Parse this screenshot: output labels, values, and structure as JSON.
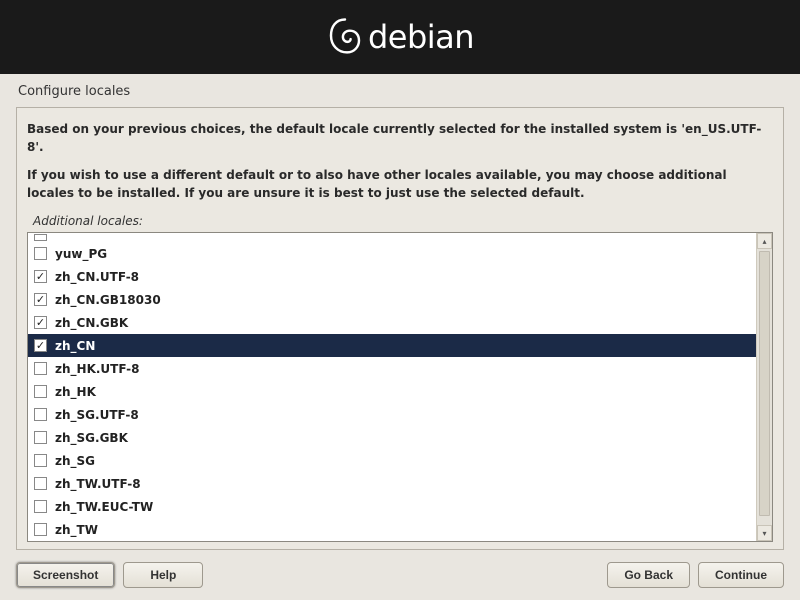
{
  "header": {
    "brand": "debian"
  },
  "title": "Configure locales",
  "description": {
    "line1": "Based on your previous choices, the default locale currently selected for the installed system is 'en_US.UTF-8'.",
    "line2": "If you wish to use a different default or to also have other locales available, you may choose additional locales to be installed. If you are unsure it is best to just use the selected default."
  },
  "list_label": "Additional locales:",
  "locales": [
    {
      "label": "yuw_PG",
      "checked": false,
      "selected": false
    },
    {
      "label": "zh_CN.UTF-8",
      "checked": true,
      "selected": false
    },
    {
      "label": "zh_CN.GB18030",
      "checked": true,
      "selected": false
    },
    {
      "label": "zh_CN.GBK",
      "checked": true,
      "selected": false
    },
    {
      "label": "zh_CN",
      "checked": true,
      "selected": true
    },
    {
      "label": "zh_HK.UTF-8",
      "checked": false,
      "selected": false
    },
    {
      "label": "zh_HK",
      "checked": false,
      "selected": false
    },
    {
      "label": "zh_SG.UTF-8",
      "checked": false,
      "selected": false
    },
    {
      "label": "zh_SG.GBK",
      "checked": false,
      "selected": false
    },
    {
      "label": "zh_SG",
      "checked": false,
      "selected": false
    },
    {
      "label": "zh_TW.UTF-8",
      "checked": false,
      "selected": false
    },
    {
      "label": "zh_TW.EUC-TW",
      "checked": false,
      "selected": false
    },
    {
      "label": "zh_TW",
      "checked": false,
      "selected": false
    }
  ],
  "buttons": {
    "screenshot": "Screenshot",
    "help": "Help",
    "goback": "Go Back",
    "continue": "Continue"
  }
}
